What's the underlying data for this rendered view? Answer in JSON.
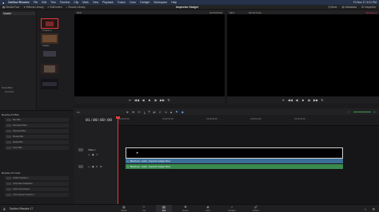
{
  "menubar": {
    "items": [
      "DaVinci Resolve",
      "File",
      "Edit",
      "Trim",
      "Timeline",
      "Clip",
      "Mark",
      "View",
      "Playback",
      "Fusion",
      "Color",
      "Fairlight",
      "Workspace",
      "Help"
    ],
    "clock": "Fri Nov 17 4:01 PM"
  },
  "toolbar": {
    "left": [
      {
        "icon": "media-pool-icon",
        "label": "Media Pool"
      },
      {
        "icon": "effects-library-icon",
        "label": "Effects Library"
      },
      {
        "icon": "edit-index-icon",
        "label": "Edit Index"
      },
      {
        "icon": "sound-library-icon",
        "label": "Sound Library"
      }
    ],
    "title": "Inspector Gadget",
    "right": [
      {
        "icon": "mixer-icon",
        "label": "Mixer"
      },
      {
        "icon": "metadata-icon",
        "label": "Metadata"
      },
      {
        "icon": "inspector-icon",
        "label": "Inspector"
      }
    ]
  },
  "media_pool": {
    "bin": "Master",
    "smart_bins_label": "Smart Bins",
    "smart_bin_item": "Keywords",
    "thumbs": [
      "Timeline 1",
      "Gadget",
      "",
      "",
      ""
    ]
  },
  "source_viewer": {
    "zoom": "69%",
    "timecode": "00:00:00:00"
  },
  "timeline_viewer": {
    "zoom": "69%",
    "timecode": "00:00:24:22",
    "timeline_name": "Timeline 1"
  },
  "effects": {
    "section1": "Resolve FX Blur",
    "items1": [
      "Box Blur",
      "Directional Blur",
      "Gaussian Blur",
      "Mosaic Blur",
      "Radial Blur",
      "Zoom Blur"
    ],
    "section2": "Resolve FX Color",
    "items2": [
      "ACES Transform",
      "Chromatic Adaptation",
      "Color Compressor",
      "Color Space Transform"
    ]
  },
  "timeline": {
    "timecode": "01:00:00:00",
    "ruler": [
      "01:00:00:00",
      "01:00:04:00",
      "01:00:08:00",
      "01:00:12:00",
      "01:00:16:00"
    ],
    "video_track": "Video 1",
    "audio_clip_1": "BlackLane - Audio - Inspector Gadget Mono",
    "audio_clip_2": "BlackLane - Audio - Inspector Gadget Mono"
  },
  "bottom": {
    "app": "DaVinci Resolve 17",
    "pages": [
      "Media",
      "Cut",
      "Edit",
      "Fusion",
      "Color",
      "Fairlight",
      "Deliver"
    ]
  },
  "colors": {
    "accent": "#e83a3a",
    "audio_blue": "#3b6e96",
    "audio_green": "#3a8a4e"
  }
}
